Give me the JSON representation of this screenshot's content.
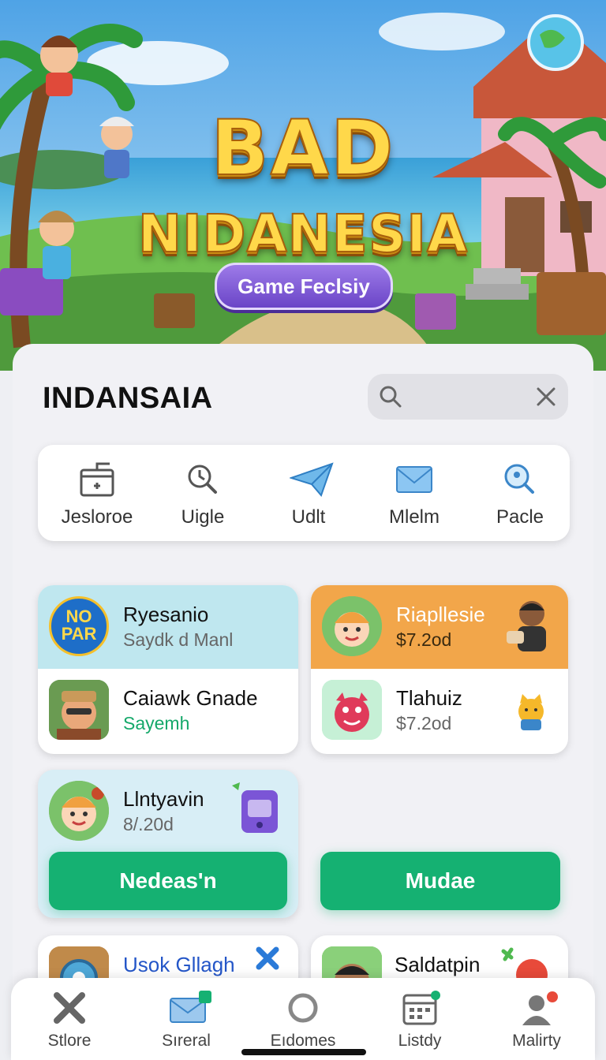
{
  "hero": {
    "title_line1": "BAD",
    "title_line2": "NIDANESIA",
    "badge": "Game Feclsiy"
  },
  "header": {
    "title": "INDANSAIA"
  },
  "quick_actions": [
    {
      "label": "Jesloroe",
      "icon": "box-icon"
    },
    {
      "label": "Uigle",
      "icon": "magnifier-icon"
    },
    {
      "label": "Udlt",
      "icon": "paper-plane-icon"
    },
    {
      "label": "Mlelm",
      "icon": "envelope-icon"
    },
    {
      "label": "Pacle",
      "icon": "search-badge-icon"
    }
  ],
  "cards": {
    "a": {
      "badge": {
        "line1": "NO",
        "line2": "PAR"
      },
      "top": {
        "title": "Ryesanio",
        "subtitle": "Saydk d Manl"
      },
      "bottom": {
        "title": "Caiawk Gnade",
        "subtitle": "Sayemh"
      }
    },
    "b": {
      "top": {
        "title": "Riapllesie",
        "subtitle": "$7.2od"
      },
      "bottom": {
        "title": "Tlahuiz",
        "subtitle": "$7.2od"
      }
    },
    "c": {
      "top": {
        "title": "Llntyavin",
        "subtitle": "8/.20d"
      },
      "button": "Nedeas'n"
    },
    "d": {
      "button": "Mudae"
    },
    "e": {
      "title": "Usok Gllagh"
    },
    "f": {
      "title": "Saldatpin"
    }
  },
  "tabs": [
    {
      "label": "Stlore",
      "icon": "tools-icon"
    },
    {
      "label": "Sıreral",
      "icon": "mail-icon"
    },
    {
      "label": "Eıdomes",
      "icon": "circle-icon"
    },
    {
      "label": "Listdy",
      "icon": "calendar-icon"
    },
    {
      "label": "Malirty",
      "icon": "profile-icon"
    }
  ],
  "colors": {
    "accent_green": "#15b172",
    "card_blue_header": "#bfe7ef",
    "card_orange_header": "#f2a64a",
    "badge_purple": "#7b55d6"
  }
}
